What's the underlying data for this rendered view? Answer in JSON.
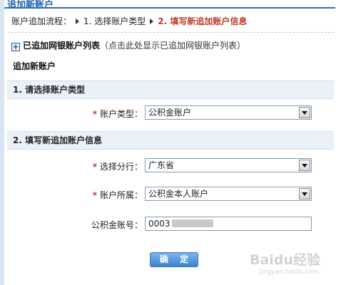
{
  "page": {
    "title": "追加新账户"
  },
  "steps": {
    "label": "账户追加流程：",
    "step1": "1. 选择账户类型",
    "step2": "2. 填写新追加账户信息"
  },
  "linked_accounts": {
    "title": "已追加网银账户列表",
    "hint": "（点击此处显示已追加网银账户列表）"
  },
  "add_heading": "追加新账户",
  "section1": {
    "title": "1. 请选择账户类型",
    "type_label": "账户类型：",
    "type_value": "公积金账户"
  },
  "section2": {
    "title": "2. 填写新追加账户信息",
    "branch_label": "选择分行：",
    "branch_value": "广东省",
    "owner_label": "账户所属：",
    "owner_value": "公积金本人账户",
    "account_label": "公积金账号：",
    "account_value": "0003"
  },
  "confirm_label": "确 定",
  "watermark": {
    "logo": "Baidu经验",
    "sub": "jingyan.baidu.com"
  },
  "colors": {
    "accent": "#2e6fb7",
    "required": "#c0392b",
    "section_bg": "#eaf1f9",
    "button": "#3c84cf"
  }
}
